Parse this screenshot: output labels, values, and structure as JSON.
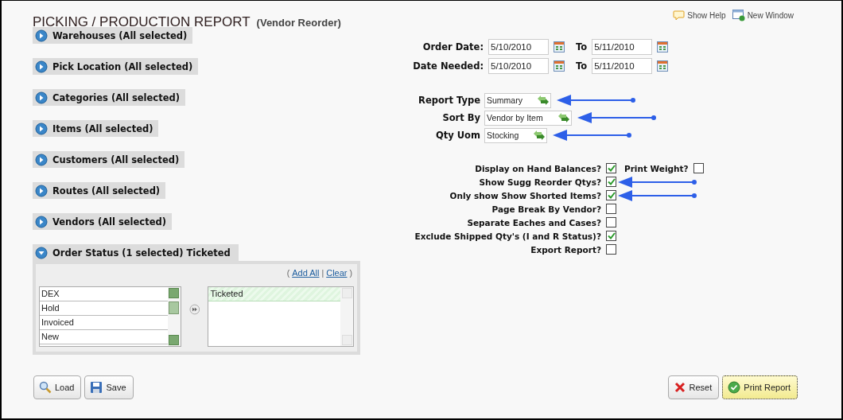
{
  "title": "PICKING / PRODUCTION REPORT",
  "subtitle": "(Vendor Reorder)",
  "header_links": [
    {
      "kind": "help",
      "label": "Show Help"
    },
    {
      "kind": "window",
      "label": "New Window"
    }
  ],
  "sections": [
    {
      "label": "Warehouses (All selected)",
      "expanded": false
    },
    {
      "label": "Pick Location (All selected)",
      "expanded": false
    },
    {
      "label": "Categories (All selected)",
      "expanded": false
    },
    {
      "label": "Items (All selected)",
      "expanded": false
    },
    {
      "label": "Customers (All selected)",
      "expanded": false
    },
    {
      "label": "Routes (All selected)",
      "expanded": false
    },
    {
      "label": "Vendors (All selected)",
      "expanded": false
    },
    {
      "label": "Order Status (1 selected) Ticketed",
      "expanded": true
    }
  ],
  "picker": {
    "open": "(",
    "sep": "|",
    "close": ")",
    "add_all": "Add All",
    "clear": "Clear",
    "available": [
      {
        "label": "DEX",
        "selected": false
      },
      {
        "label": "Hold",
        "selected": false
      },
      {
        "label": "Invoiced",
        "selected": false
      },
      {
        "label": "New",
        "selected": false
      }
    ],
    "chosen": [
      {
        "label": "Ticketed",
        "selected": true
      }
    ]
  },
  "dates": [
    {
      "label": "Order Date:",
      "from": "5/10/2010",
      "to_label": "To",
      "to": "5/11/2010"
    },
    {
      "label": "Date Needed:",
      "from": "5/10/2010",
      "to_label": "To",
      "to": "5/11/2010"
    }
  ],
  "selects": [
    {
      "label": "Report Type",
      "value": "Summary",
      "annotated": true
    },
    {
      "label": "Sort By",
      "value": "Vendor by Item",
      "annotated": true
    },
    {
      "label": "Qty Uom",
      "value": "Stocking",
      "annotated": true
    }
  ],
  "options": [
    {
      "label": "Display on Hand Balances?",
      "checked": true,
      "annotated": false,
      "extra": {
        "label": "Print Weight?",
        "checked": false
      }
    },
    {
      "label": "Show Sugg Reorder Qtys?",
      "checked": true,
      "annotated": true
    },
    {
      "label": "Only show Show Shorted Items?",
      "checked": true,
      "annotated": true
    },
    {
      "label": "Page Break By Vendor?",
      "checked": false,
      "annotated": false
    },
    {
      "label": "Separate Eaches and Cases?",
      "checked": false,
      "annotated": false
    },
    {
      "label": "Exclude Shipped Qty's (I and R Status)?",
      "checked": true,
      "annotated": false
    },
    {
      "label": "Export Report?",
      "checked": false,
      "annotated": false
    }
  ],
  "buttons_left": [
    {
      "kind": "load",
      "label": "Load"
    },
    {
      "kind": "save",
      "label": "Save"
    }
  ],
  "buttons_right": [
    {
      "kind": "reset",
      "label": "Reset",
      "primary": false
    },
    {
      "kind": "print",
      "label": "Print Report",
      "primary": true
    }
  ]
}
